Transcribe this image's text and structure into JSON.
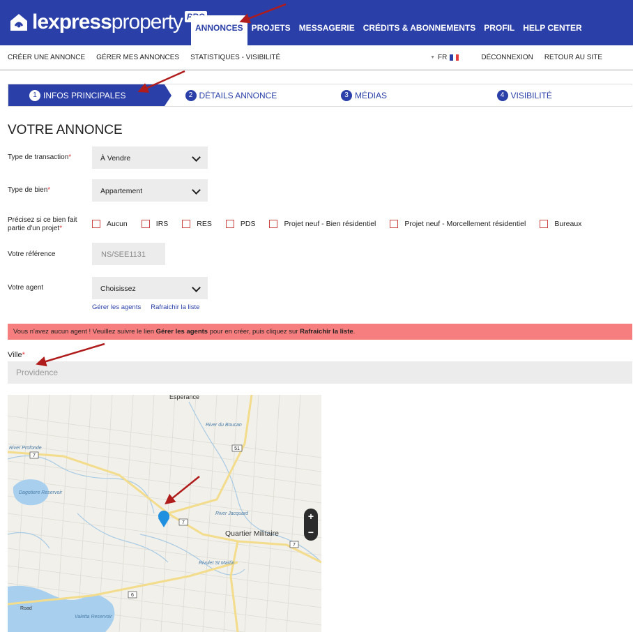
{
  "brand": {
    "name_bold": "lexpress",
    "name_light": "property",
    "badge": "PRO"
  },
  "main_nav": [
    "ANNONCES",
    "PROJETS",
    "MESSAGERIE",
    "CRÉDITS & ABONNEMENTS",
    "PROFIL",
    "HELP CENTER"
  ],
  "sub_nav": {
    "left": [
      "CRÉER UNE ANNONCE",
      "GÉRER MES ANNONCES",
      "STATISTIQUES - VISIBILITÉ"
    ],
    "language": "FR",
    "right": [
      "DÉCONNEXION",
      "RETOUR AU SITE"
    ]
  },
  "steps": [
    {
      "num": "1",
      "label": "INFOS PRINCIPALES"
    },
    {
      "num": "2",
      "label": "DÉTAILS ANNONCE"
    },
    {
      "num": "3",
      "label": "MÉDIAS"
    },
    {
      "num": "4",
      "label": "VISIBILITÉ"
    }
  ],
  "form": {
    "title": "VOTRE ANNONCE",
    "transaction_label": "Type de transaction",
    "transaction_value": "À Vendre",
    "property_label": "Type de bien",
    "property_value": "Appartement",
    "project_label_1": "Précisez si ce bien fait",
    "project_label_2": "partie d'un projet",
    "project_options": [
      "Aucun",
      "IRS",
      "RES",
      "PDS",
      "Projet neuf - Bien résidentiel",
      "Projet neuf - Morcellement résidentiel",
      "Bureaux"
    ],
    "reference_label": "Votre référence",
    "reference_value": "NS/SEE1131",
    "agent_label": "Votre agent",
    "agent_value": "Choisissez",
    "manage_agents_link": "Gérer les agents",
    "refresh_link": "Rafraichir la liste",
    "alert_part1": "Vous n'avez aucun agent ! Veuillez suivre le lien ",
    "alert_link1": "Gérer les agents",
    "alert_part2": " pour en créer, puis cliquez sur ",
    "alert_link2": "Rafraichir la liste",
    "alert_part3": ".",
    "ville_label": "Ville",
    "ville_placeholder": "Providence"
  },
  "map": {
    "labels": [
      "Esperance",
      "River du Boucan",
      "River Profonde",
      "Dagotiere Reservoir",
      "River Jacquard",
      "Quartier Militaire",
      "Rivulet St Martin",
      "Valetta Reservoir",
      "Road"
    ],
    "road_shields": [
      "51",
      "7",
      "7",
      "7",
      "6"
    ],
    "zoom_in": "+",
    "zoom_out": "−"
  },
  "colors": {
    "brand_blue": "#2a3fa8",
    "alert_red": "#f77e7e",
    "annotation_arrow": "#b01c1c",
    "required": "#e53c3c"
  }
}
